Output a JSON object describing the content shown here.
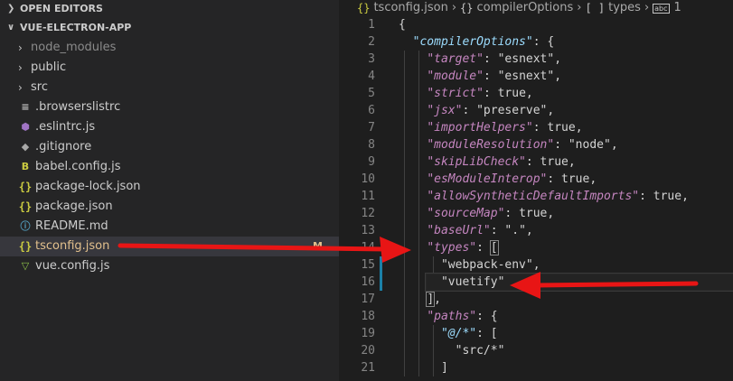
{
  "explorer": {
    "open_editors": "OPEN EDITORS",
    "project": "VUE-ELECTRON-APP",
    "items": [
      {
        "label": "node_modules",
        "kind": "folder"
      },
      {
        "label": "public",
        "kind": "folder"
      },
      {
        "label": "src",
        "kind": "folder"
      },
      {
        "label": ".browserslistrc",
        "icon": "lines"
      },
      {
        "label": ".eslintrc.js",
        "icon": "eslint"
      },
      {
        "label": ".gitignore",
        "icon": "git"
      },
      {
        "label": "babel.config.js",
        "icon": "babel"
      },
      {
        "label": "package-lock.json",
        "icon": "brace"
      },
      {
        "label": "package.json",
        "icon": "brace"
      },
      {
        "label": "README.md",
        "icon": "info"
      },
      {
        "label": "tsconfig.json",
        "icon": "brace",
        "badge": "M"
      },
      {
        "label": "vue.config.js",
        "icon": "vue"
      }
    ]
  },
  "breadcrumb": {
    "file": "tsconfig.json",
    "seg1": "compilerOptions",
    "seg2": "types",
    "seg3": "1"
  },
  "lines": [
    {
      "n": "1"
    },
    {
      "n": "2"
    },
    {
      "n": "3"
    },
    {
      "n": "4"
    },
    {
      "n": "5"
    },
    {
      "n": "6"
    },
    {
      "n": "7"
    },
    {
      "n": "8"
    },
    {
      "n": "9"
    },
    {
      "n": "10"
    },
    {
      "n": "11"
    },
    {
      "n": "12"
    },
    {
      "n": "13"
    },
    {
      "n": "14"
    },
    {
      "n": "15"
    },
    {
      "n": "16"
    },
    {
      "n": "17"
    },
    {
      "n": "18"
    },
    {
      "n": "19"
    },
    {
      "n": "20"
    },
    {
      "n": "21"
    }
  ],
  "code": {
    "l1": "{",
    "compilerOptions": "\"compilerOptions\"",
    "target": "\"target\"",
    "target_v": "\"esnext\"",
    "module": "\"module\"",
    "module_v": "\"esnext\"",
    "strict": "\"strict\"",
    "strict_v": "true",
    "jsx": "\"jsx\"",
    "jsx_v": "\"preserve\"",
    "importHelpers": "\"importHelpers\"",
    "importHelpers_v": "true",
    "moduleResolution": "\"moduleResolution\"",
    "moduleResolution_v": "\"node\"",
    "skipLibCheck": "\"skipLibCheck\"",
    "skipLibCheck_v": "true",
    "esModuleInterop": "\"esModuleInterop\"",
    "esModuleInterop_v": "true",
    "allowSyntheticDefaultImports": "\"allowSyntheticDefaultImports\"",
    "allowSyntheticDefaultImports_v": "true",
    "sourceMap": "\"sourceMap\"",
    "sourceMap_v": "true",
    "baseUrl": "\"baseUrl\"",
    "baseUrl_v": "\".\"",
    "types": "\"types\"",
    "webpack_env": "\"webpack-env\"",
    "vuetify": "\"vuetify\"",
    "paths": "\"paths\"",
    "at": "\"@/*\"",
    "src": "\"src/*\""
  },
  "colors": {
    "arrow": "#e81515"
  }
}
